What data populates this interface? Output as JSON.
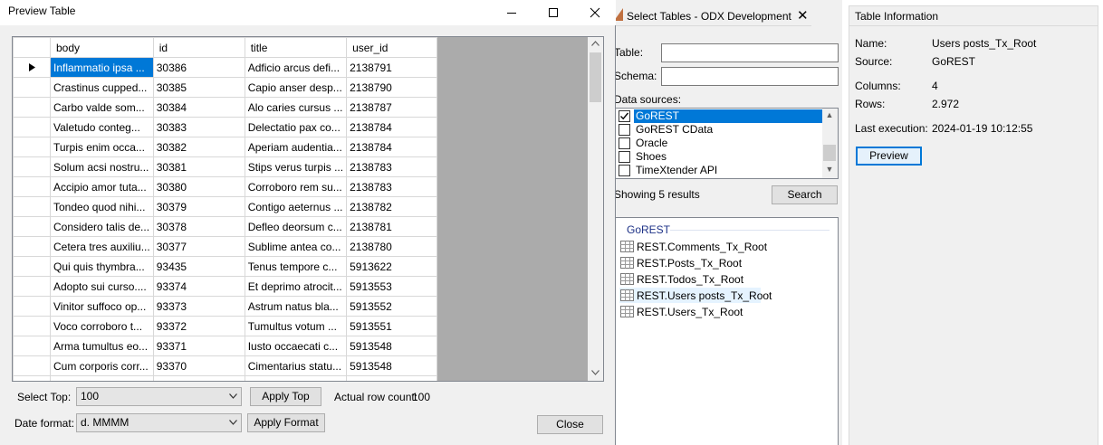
{
  "dialog": {
    "title": "Preview Table",
    "grid": {
      "columns": [
        "body",
        "id",
        "title",
        "user_id"
      ],
      "rows": [
        [
          "Inflammatio ipsa ...",
          "30386",
          "Adficio arcus defi...",
          "2138791"
        ],
        [
          "Crastinus cupped...",
          "30385",
          "Capio anser desp...",
          "2138790"
        ],
        [
          "Carbo valde som...",
          "30384",
          "Alo caries cursus ...",
          "2138787"
        ],
        [
          "Valetudo conteg...",
          "30383",
          "Delectatio pax co...",
          "2138784"
        ],
        [
          "Turpis enim occa...",
          "30382",
          "Aperiam audentia...",
          "2138784"
        ],
        [
          "Solum acsi nostru...",
          "30381",
          "Stips verus turpis ...",
          "2138783"
        ],
        [
          "Accipio amor tuta...",
          "30380",
          "Corroboro rem su...",
          "2138783"
        ],
        [
          "Tondeo quod nihi...",
          "30379",
          "Contigo aeternus ...",
          "2138782"
        ],
        [
          "Considero talis de...",
          "30378",
          "Defleo deorsum c...",
          "2138781"
        ],
        [
          "Cetera tres auxiliu...",
          "30377",
          "Sublime antea co...",
          "2138780"
        ],
        [
          "Qui quis thymbra...",
          "93435",
          "Tenus tempore c...",
          "5913622"
        ],
        [
          "Adopto sui curso....",
          "93374",
          "Et deprimo atrocit...",
          "5913553"
        ],
        [
          "Vinitor suffoco op...",
          "93373",
          "Astrum natus bla...",
          "5913552"
        ],
        [
          "Voco corroboro t...",
          "93372",
          "Tumultus votum ...",
          "5913551"
        ],
        [
          "Arma tumultus eo...",
          "93371",
          "Iusto occaecati c...",
          "5913548"
        ],
        [
          "Cum corporis corr...",
          "93370",
          "Cimentarius statu...",
          "5913548"
        ]
      ]
    },
    "select_top_label": "Select Top:",
    "select_top_value": "100",
    "apply_top_label": "Apply Top",
    "row_count_label": "Actual row count:",
    "row_count_value": "100",
    "date_format_label": "Date format:",
    "date_format_value": "d. MMMM",
    "apply_format_label": "Apply Format",
    "close_label": "Close"
  },
  "select_tables": {
    "tab_title": "Select Tables - ODX Development",
    "table_label": "Table:",
    "table_value": "",
    "schema_label": "Schema:",
    "schema_value": "",
    "data_sources_label": "Data sources:",
    "data_sources": [
      {
        "name": "GoREST",
        "checked": true
      },
      {
        "name": "GoREST CData",
        "checked": false
      },
      {
        "name": "Oracle",
        "checked": false
      },
      {
        "name": "Shoes",
        "checked": false
      },
      {
        "name": "TimeXtender API",
        "checked": false
      }
    ],
    "results_text": "Showing 5 results",
    "search_label": "Search",
    "group_name": "GoREST",
    "results": [
      "REST.Comments_Tx_Root",
      "REST.Posts_Tx_Root",
      "REST.Todos_Tx_Root",
      "REST.Users posts_Tx_Root",
      "REST.Users_Tx_Root"
    ]
  },
  "table_info": {
    "header": "Table Information",
    "name_label": "Name:",
    "name_value": "Users posts_Tx_Root",
    "source_label": "Source:",
    "source_value": "GoREST",
    "columns_label": "Columns:",
    "columns_value": "4",
    "rows_label": "Rows:",
    "rows_value": "2.972",
    "last_exec_label": "Last execution:",
    "last_exec_value": "2024-01-19 10:12:55",
    "preview_label": "Preview"
  },
  "colors": {
    "selection": "#0078d7",
    "group_header": "#1e3287",
    "panel_bg": "#f0f0f0"
  }
}
